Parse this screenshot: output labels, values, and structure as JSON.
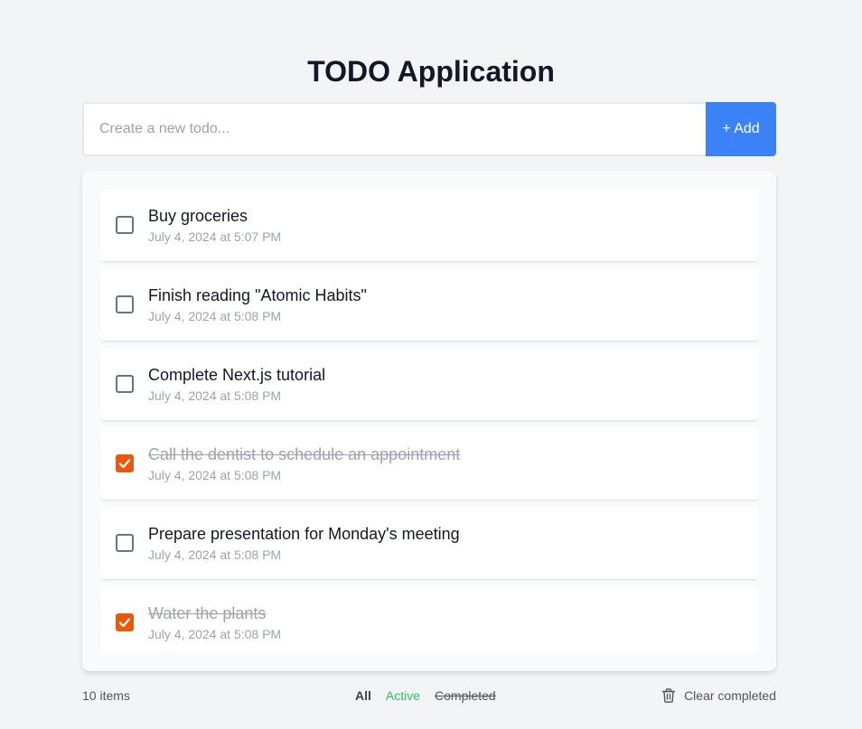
{
  "app": {
    "title": "TODO Application"
  },
  "new_todo": {
    "placeholder": "Create a new todo...",
    "value": "",
    "add_label": "+ Add"
  },
  "todos": [
    {
      "title": "Buy groceries",
      "date": "July 4, 2024 at 5:07 PM",
      "completed": false
    },
    {
      "title": "Finish reading \"Atomic Habits\"",
      "date": "July 4, 2024 at 5:08 PM",
      "completed": false
    },
    {
      "title": "Complete Next.js tutorial",
      "date": "July 4, 2024 at 5:08 PM",
      "completed": false
    },
    {
      "title": "Call the dentist to schedule an appointment",
      "date": "July 4, 2024 at 5:08 PM",
      "completed": true
    },
    {
      "title": "Prepare presentation for Monday's meeting",
      "date": "July 4, 2024 at 5:08 PM",
      "completed": false
    },
    {
      "title": "Water the plants",
      "date": "July 4, 2024 at 5:08 PM",
      "completed": true
    }
  ],
  "footer": {
    "count_label": "10 items",
    "filters": {
      "all": "All",
      "active": "Active",
      "completed": "Completed"
    },
    "selected_filter": "all",
    "clear_label": "Clear completed",
    "clear_icon": "trash-icon"
  },
  "colors": {
    "accent": "#3b82f6",
    "checked": "#ea580c",
    "active_filter": "#22c55e",
    "background": "#f3f4f6"
  }
}
